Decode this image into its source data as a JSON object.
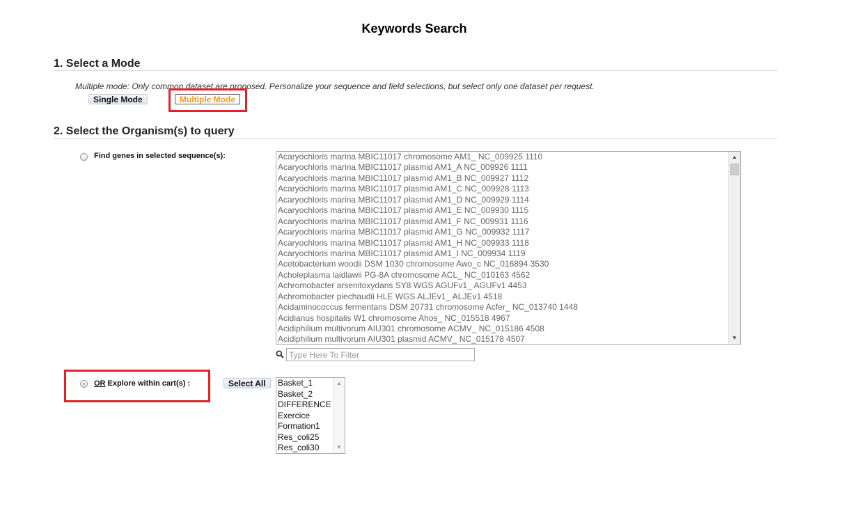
{
  "page_title": "Keywords Search",
  "section1": {
    "heading": "1. Select a Mode",
    "description": "Multiple mode: Only common dataset are proposed. Personalize your sequence and field selections, but select only one dataset per request.",
    "single_mode_label": "Single Mode",
    "multiple_mode_label": "Multiple Mode",
    "active_mode_color": "#f59a1a"
  },
  "section2": {
    "heading": "2. Select the Organism(s) to query",
    "find_genes_label": "Find genes in selected sequence(s):",
    "sequences": [
      "Acaryochloris marina MBIC11017 chromosome AM1_ NC_009925 1110",
      "Acaryochloris marina MBIC11017 plasmid AM1_A NC_009926 1111",
      "Acaryochloris marina MBIC11017 plasmid AM1_B NC_009927 1112",
      "Acaryochloris marina MBIC11017 plasmid AM1_C NC_009928 1113",
      "Acaryochloris marina MBIC11017 plasmid AM1_D NC_009929 1114",
      "Acaryochloris marina MBIC11017 plasmid AM1_E NC_009930 1115",
      "Acaryochloris marina MBIC11017 plasmid AM1_F NC_009931 1116",
      "Acaryochloris marina MBIC11017 plasmid AM1_G NC_009932 1117",
      "Acaryochloris marina MBIC11017 plasmid AM1_H NC_009933 1118",
      "Acaryochloris marina MBIC11017 plasmid AM1_I NC_009934 1119",
      "Acetobacterium woodii DSM 1030 chromosome Awo_c NC_016894 3530",
      "Acholeplasma laidlawii PG-8A chromosome ACL_ NC_010163 4562",
      "Achromobacter arsenitoxydans SY8 WGS AGUFv1_ AGUFv1 4453",
      "Achromobacter piechaudii HLE WGS ALJEv1_ ALJEv1 4518",
      "Acidaminococcus fermentans DSM 20731 chromosome Acfer_ NC_013740 1448",
      "Acidianus hospitalis W1 chromosome Ahos_ NC_015518 4967",
      "Acidiphilium multivorum AIU301 chromosome ACMV_ NC_015186 4508",
      "Acidiphilium multivorum AIU301 plasmid ACMV_ NC_015178 4507"
    ],
    "filter_placeholder": "Type Here To Filter",
    "or_prefix": "OR",
    "explore_label": " Explore within cart(s) :",
    "select_all_label": "Select All",
    "carts": [
      "Basket_1",
      "Basket_2",
      "DIFFERENCE",
      "Exercice",
      "Formation1",
      "Res_coli25",
      "Res_coli30"
    ]
  },
  "icons": {
    "search": "search-icon",
    "scroll_up": "chevron-up-icon",
    "scroll_down": "chevron-down-icon"
  },
  "highlight_color": "#e4202a"
}
